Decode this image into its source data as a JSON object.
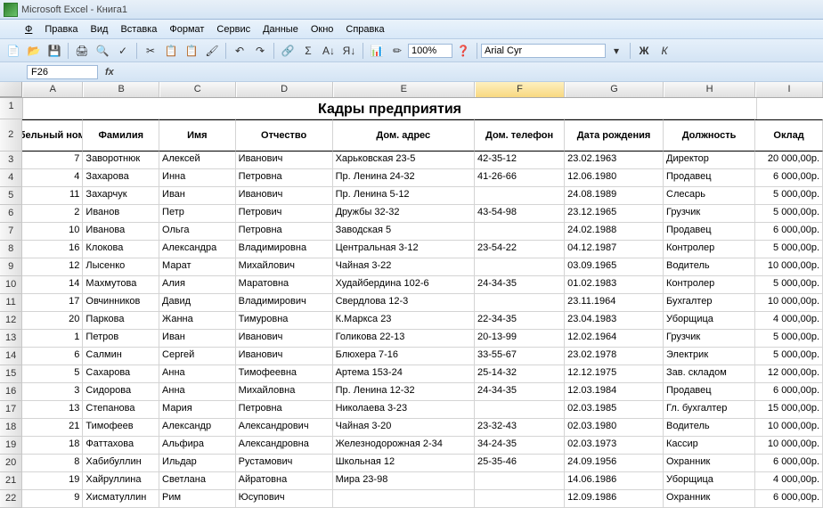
{
  "app": {
    "title": "Microsoft Excel - Книга1"
  },
  "menu": {
    "file": "Файл",
    "edit": "Правка",
    "view": "Вид",
    "insert": "Вставка",
    "format": "Формат",
    "service": "Сервис",
    "data": "Данные",
    "window": "Окно",
    "help": "Справка"
  },
  "toolbar": {
    "zoom": "100%",
    "font": "Arial Cyr"
  },
  "namebox": "F26",
  "cols": [
    "A",
    "B",
    "C",
    "D",
    "E",
    "F",
    "G",
    "H",
    "I"
  ],
  "title": "Кадры предприятия",
  "headers": {
    "tab": "Табельный номер",
    "fam": "Фамилия",
    "name": "Имя",
    "otch": "Отчество",
    "addr": "Дом. адрес",
    "tel": "Дом. телефон",
    "birth": "Дата рождения",
    "pos": "Должность",
    "sal": "Оклад"
  },
  "rows": [
    {
      "n": "7",
      "fam": "Заворотнюк",
      "name": "Алексей",
      "otch": "Иванович",
      "addr": "Харьковская 23-5",
      "tel": "42-35-12",
      "birth": "23.02.1963",
      "pos": "Директор",
      "sal": "20 000,00р."
    },
    {
      "n": "4",
      "fam": "Захарова",
      "name": "Инна",
      "otch": "Петровна",
      "addr": "Пр. Ленина 24-32",
      "tel": "41-26-66",
      "birth": "12.06.1980",
      "pos": "Продавец",
      "sal": "6 000,00р."
    },
    {
      "n": "11",
      "fam": "Захарчук",
      "name": "Иван",
      "otch": "Иванович",
      "addr": "Пр. Ленина 5-12",
      "tel": "",
      "birth": "24.08.1989",
      "pos": "Слесарь",
      "sal": "5 000,00р."
    },
    {
      "n": "2",
      "fam": "Иванов",
      "name": "Петр",
      "otch": "Петрович",
      "addr": "Дружбы 32-32",
      "tel": "43-54-98",
      "birth": "23.12.1965",
      "pos": "Грузчик",
      "sal": "5 000,00р."
    },
    {
      "n": "10",
      "fam": "Иванова",
      "name": "Ольга",
      "otch": "Петровна",
      "addr": "Заводская 5",
      "tel": "",
      "birth": "24.02.1988",
      "pos": "Продавец",
      "sal": "6 000,00р."
    },
    {
      "n": "16",
      "fam": "Клокова",
      "name": "Александра",
      "otch": "Владимировна",
      "addr": "Центральная 3-12",
      "tel": "23-54-22",
      "birth": "04.12.1987",
      "pos": "Контролер",
      "sal": "5 000,00р."
    },
    {
      "n": "12",
      "fam": "Лысенко",
      "name": "Марат",
      "otch": "Михайлович",
      "addr": "Чайная 3-22",
      "tel": "",
      "birth": "03.09.1965",
      "pos": "Водитель",
      "sal": "10 000,00р."
    },
    {
      "n": "14",
      "fam": "Махмутова",
      "name": "Алия",
      "otch": "Маратовна",
      "addr": "Худайбердина 102-6",
      "tel": "24-34-35",
      "birth": "01.02.1983",
      "pos": "Контролер",
      "sal": "5 000,00р."
    },
    {
      "n": "17",
      "fam": "Овчинников",
      "name": "Давид",
      "otch": "Владимирович",
      "addr": "Свердлова 12-3",
      "tel": "",
      "birth": "23.11.1964",
      "pos": "Бухгалтер",
      "sal": "10 000,00р."
    },
    {
      "n": "20",
      "fam": "Паркова",
      "name": "Жанна",
      "otch": "Тимуровна",
      "addr": "К.Маркса 23",
      "tel": "22-34-35",
      "birth": "23.04.1983",
      "pos": "Уборщица",
      "sal": "4 000,00р."
    },
    {
      "n": "1",
      "fam": "Петров",
      "name": "Иван",
      "otch": "Иванович",
      "addr": "Голикова 22-13",
      "tel": "20-13-99",
      "birth": "12.02.1964",
      "pos": "Грузчик",
      "sal": "5 000,00р."
    },
    {
      "n": "6",
      "fam": "Салмин",
      "name": "Сергей",
      "otch": "Иванович",
      "addr": "Блюхера 7-16",
      "tel": "33-55-67",
      "birth": "23.02.1978",
      "pos": "Электрик",
      "sal": "5 000,00р."
    },
    {
      "n": "5",
      "fam": "Сахарова",
      "name": "Анна",
      "otch": "Тимофеевна",
      "addr": "Артема 153-24",
      "tel": "25-14-32",
      "birth": "12.12.1975",
      "pos": "Зав. складом",
      "sal": "12 000,00р."
    },
    {
      "n": "3",
      "fam": "Сидорова",
      "name": "Анна",
      "otch": "Михайловна",
      "addr": "Пр. Ленина 12-32",
      "tel": "24-34-35",
      "birth": "12.03.1984",
      "pos": "Продавец",
      "sal": "6 000,00р."
    },
    {
      "n": "13",
      "fam": "Степанова",
      "name": "Мария",
      "otch": "Петровна",
      "addr": "Николаева 3-23",
      "tel": "",
      "birth": "02.03.1985",
      "pos": "Гл. бухгалтер",
      "sal": "15 000,00р."
    },
    {
      "n": "21",
      "fam": "Тимофеев",
      "name": "Александр",
      "otch": "Александрович",
      "addr": "Чайная 3-20",
      "tel": "23-32-43",
      "birth": "02.03.1980",
      "pos": "Водитель",
      "sal": "10 000,00р."
    },
    {
      "n": "18",
      "fam": "Фаттахова",
      "name": "Альфира",
      "otch": "Александровна",
      "addr": "Железнодорожная 2-34",
      "tel": "34-24-35",
      "birth": "02.03.1973",
      "pos": "Кассир",
      "sal": "10 000,00р."
    },
    {
      "n": "8",
      "fam": "Хабибуллин",
      "name": "Ильдар",
      "otch": "Рустамович",
      "addr": "Школьная 12",
      "tel": "25-35-46",
      "birth": "24.09.1956",
      "pos": "Охранник",
      "sal": "6 000,00р."
    },
    {
      "n": "19",
      "fam": "Хайруллина",
      "name": "Светлана",
      "otch": "Айратовна",
      "addr": "Мира 23-98",
      "tel": "",
      "birth": "14.06.1986",
      "pos": "Уборщица",
      "sal": "4 000,00р."
    },
    {
      "n": "9",
      "fam": "Хисматуллин",
      "name": "Рим",
      "otch": "Юсупович",
      "addr": "",
      "tel": "",
      "birth": "12.09.1986",
      "pos": "Охранник",
      "sal": "6 000,00р."
    }
  ]
}
